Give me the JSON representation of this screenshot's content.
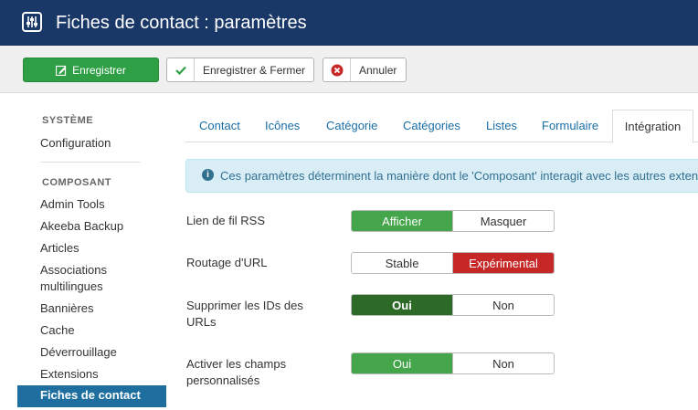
{
  "header": {
    "title": "Fiches de contact : paramètres",
    "icon": "sliders-icon"
  },
  "toolbar": {
    "save_label": "Enregistrer",
    "save_close_label": "Enregistrer & Fermer",
    "cancel_label": "Annuler",
    "colors": {
      "save": "#2f9f45",
      "cancel_icon": "#c52827"
    }
  },
  "sidebar": {
    "system_heading": "SYSTÈME",
    "configuration": "Configuration",
    "component_heading": "COMPOSANT",
    "items": [
      "Admin Tools",
      "Akeeba Backup",
      "Articles",
      "Associations multilingues",
      "Bannières",
      "Cache",
      "Déverrouillage",
      "Extensions"
    ],
    "active_item": "Fiches de contact"
  },
  "tabs": [
    "Contact",
    "Icônes",
    "Catégorie",
    "Catégories",
    "Listes",
    "Formulaire"
  ],
  "active_tab": "Intégration",
  "alert": {
    "icon": "info-icon",
    "text": "Ces paramètres déterminent la manière dont le 'Composant' interagit avec les autres exten"
  },
  "fields": [
    {
      "label": "Lien de fil RSS",
      "options": [
        "Afficher",
        "Masquer"
      ],
      "selected": "Afficher"
    },
    {
      "label": "Routage d'URL",
      "options": [
        "Stable",
        "Expérimental"
      ],
      "selected": "Expérimental"
    },
    {
      "label": "Supprimer les IDs des URLs",
      "options": [
        "Oui",
        "Non"
      ],
      "selected": "Oui"
    },
    {
      "label": "Activer les champs personnalisés",
      "options": [
        "Oui",
        "Non"
      ],
      "selected": "Oui"
    }
  ]
}
